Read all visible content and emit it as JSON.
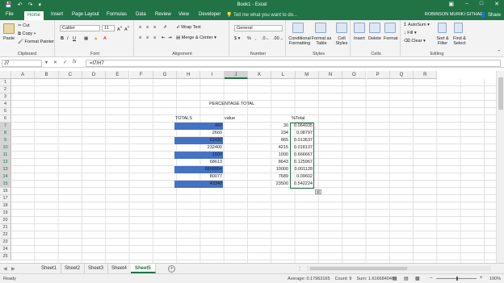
{
  "app": {
    "title": "Book1 - Excel",
    "user": "ROBINSON MURIKI GITHAE",
    "share_label": "Share",
    "tell_me_placeholder": "Tell me what you want to do..."
  },
  "ribbon_tabs": [
    "File",
    "Home",
    "Insert",
    "Page Layout",
    "Formulas",
    "Data",
    "Review",
    "View",
    "Developer"
  ],
  "ribbon": {
    "clipboard": {
      "label": "Clipboard",
      "paste": "Paste",
      "cut": "Cut",
      "copy": "Copy",
      "format_painter": "Format Painter"
    },
    "font": {
      "label": "Font",
      "name": "Calibri",
      "size": "11"
    },
    "alignment": {
      "label": "Alignment",
      "wrap_text": "Wrap Text",
      "merge_center": "Merge & Center"
    },
    "number": {
      "label": "Number",
      "format": "General"
    },
    "styles": {
      "label": "Styles",
      "conditional_formatting": "Conditional Formatting",
      "format_as_table": "Format as Table",
      "cell_styles": "Cell Styles"
    },
    "cells": {
      "label": "Cells",
      "insert": "Insert",
      "delete": "Delete",
      "format": "Format"
    },
    "editing": {
      "label": "Editing",
      "autosum": "AutoSum",
      "fill": "Fill",
      "clear": "Clear",
      "sort_filter": "Sort & Filter",
      "find_select": "Find & Select"
    }
  },
  "formula_bar": {
    "name_box": "J7",
    "formula": "=I7/H7"
  },
  "columns": [
    "A",
    "B",
    "C",
    "D",
    "E",
    "F",
    "G",
    "H",
    "I",
    "J",
    "K",
    "L",
    "M",
    "N",
    "O",
    "P",
    "Q",
    "R"
  ],
  "rows": [
    "1",
    "2",
    "3",
    "4",
    "5",
    "6",
    "7",
    "8",
    "9",
    "10",
    "11",
    "12",
    "13",
    "14",
    "15",
    "16",
    "17",
    "18",
    "19",
    "20",
    "21",
    "22",
    "23",
    "24",
    "25"
  ],
  "sheet": {
    "heading": "PERCENTAGE TOTAL",
    "header_totals": "TOTALS",
    "header_value": "value",
    "header_pct": "%Total",
    "data": [
      {
        "totals": "462",
        "value": "30",
        "pct": "0.064935"
      },
      {
        "totals": "2660",
        "value": "234",
        "pct": "0.08797"
      },
      {
        "totals": "63430",
        "value": "865",
        "pct": "0.013637"
      },
      {
        "totals": "232400",
        "value": "4215",
        "pct": "0.018137"
      },
      {
        "totals": "1500",
        "value": "1000",
        "pct": "0.666667"
      },
      {
        "totals": "68613",
        "value": "8643",
        "pct": "0.125967"
      },
      {
        "totals": "8868864",
        "value": "10000",
        "pct": "0.001128"
      },
      {
        "totals": "80077",
        "value": "7689",
        "pct": "0.09602"
      },
      {
        "totals": "43340",
        "value": "23500",
        "pct": "0.542224"
      }
    ]
  },
  "sheet_tabs": [
    "Sheet1",
    "Sheet2",
    "Sheet3",
    "Sheet4",
    "Sheet5"
  ],
  "active_sheet": "Sheet5",
  "status": {
    "ready": "Ready",
    "average": "Average: 0.17963165",
    "count": "Count: 9",
    "sum": "Sum: 1.616684046",
    "zoom": "100%"
  },
  "colors": {
    "excel_green": "#217346",
    "fill_blue": "#4472c4"
  }
}
